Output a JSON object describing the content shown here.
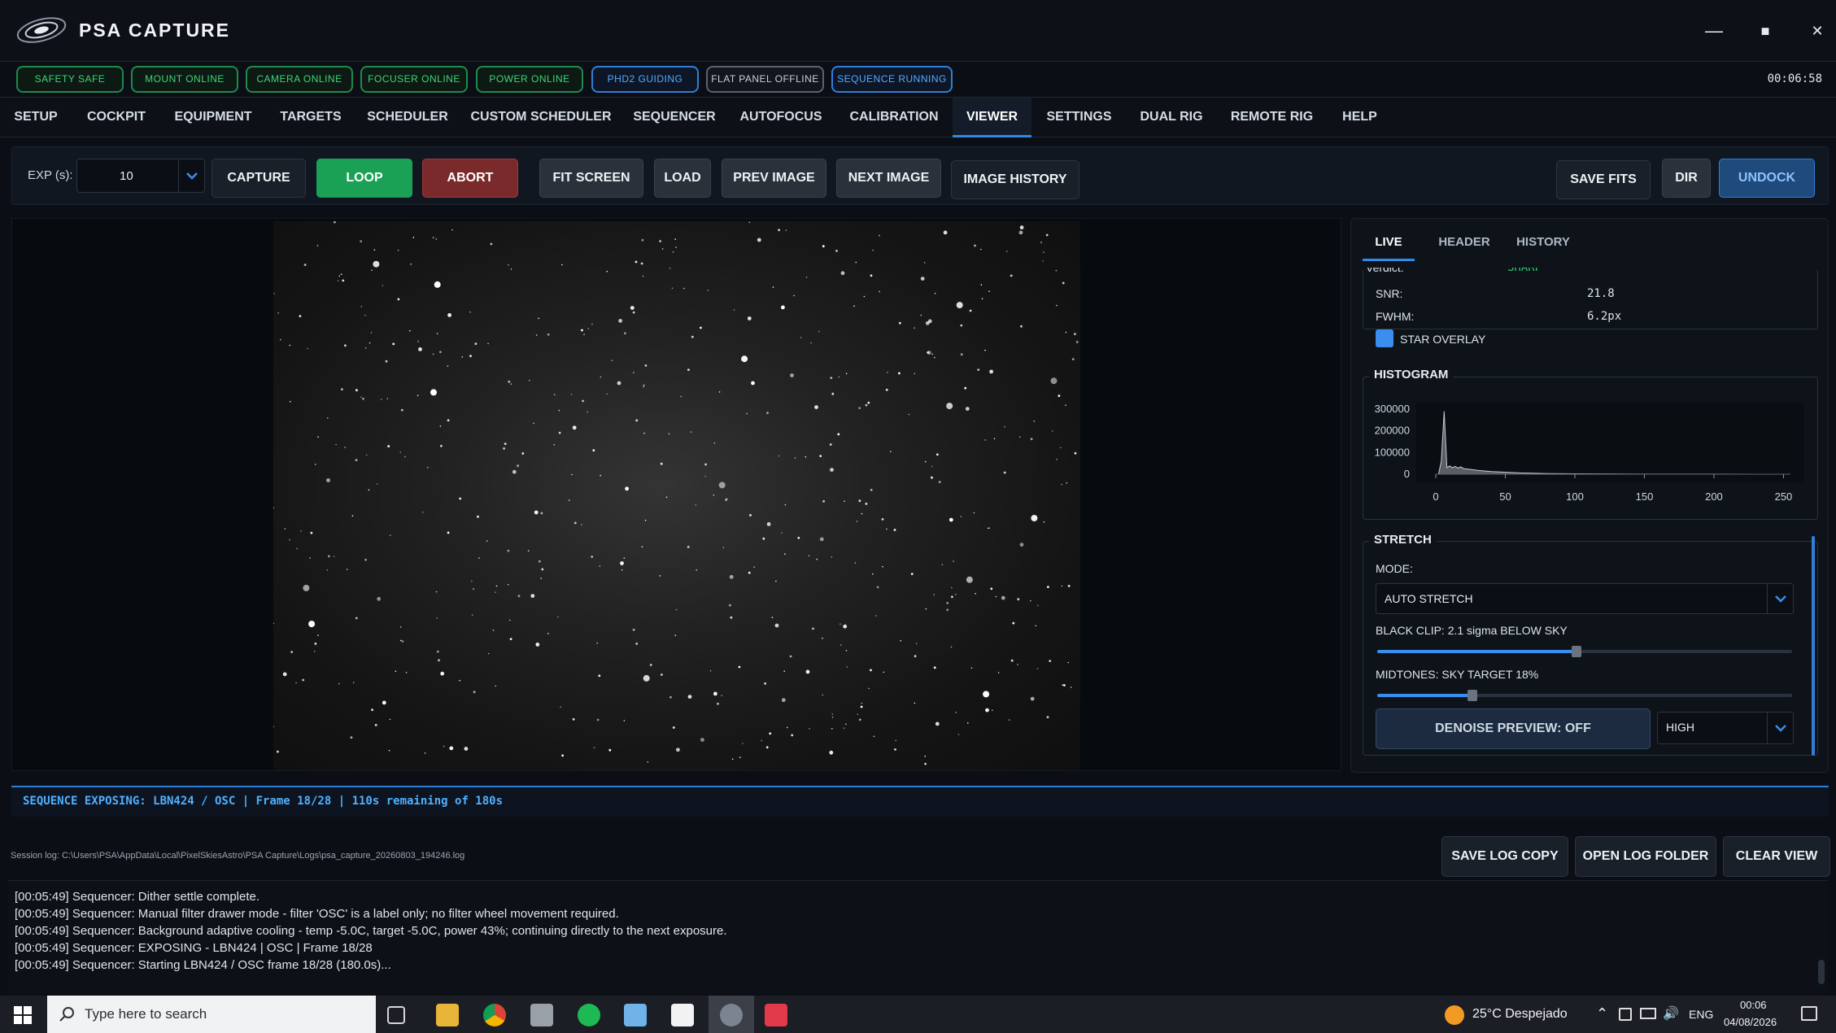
{
  "app": {
    "title": "PSA CAPTURE",
    "window": {
      "minimize": "—",
      "maximize": "■",
      "close": "✕"
    }
  },
  "status": {
    "pills": [
      {
        "label": "SAFETY SAFE",
        "kind": "green"
      },
      {
        "label": "MOUNT ONLINE",
        "kind": "green"
      },
      {
        "label": "CAMERA ONLINE",
        "kind": "green"
      },
      {
        "label": "FOCUSER ONLINE",
        "kind": "green"
      },
      {
        "label": "POWER ONLINE",
        "kind": "green"
      },
      {
        "label": "PHD2 GUIDING",
        "kind": "blue"
      },
      {
        "label": "FLAT PANEL OFFLINE",
        "kind": "grey"
      },
      {
        "label": "SEQUENCE RUNNING",
        "kind": "blue"
      }
    ],
    "elapsed": "00:06:58"
  },
  "tabs": [
    "SETUP",
    "COCKPIT",
    "EQUIPMENT",
    "TARGETS",
    "SCHEDULER",
    "CUSTOM SCHEDULER",
    "SEQUENCER",
    "AUTOFOCUS",
    "CALIBRATION",
    "VIEWER",
    "SETTINGS",
    "DUAL RIG",
    "REMOTE RIG",
    "HELP"
  ],
  "active_tab": "VIEWER",
  "toolbar": {
    "exp_label": "EXP (s):",
    "exp_value": "10",
    "capture": "CAPTURE",
    "loop": "LOOP",
    "abort": "ABORT",
    "fit_screen": "FIT SCREEN",
    "load": "LOAD",
    "prev_image": "PREV IMAGE",
    "next_image": "NEXT IMAGE",
    "image_history": "IMAGE HISTORY",
    "save_fits": "SAVE FITS",
    "dir": "DIR",
    "undock": "UNDOCK"
  },
  "side": {
    "tabs": [
      "LIVE",
      "HEADER",
      "HISTORY"
    ],
    "verdict_label": "Verdict:",
    "verdict_value": "SHARP",
    "snr_label": "SNR:",
    "snr_value": "21.8",
    "fwhm_label": "FWHM:",
    "fwhm_value": "6.2px",
    "star_overlay": "STAR OVERLAY",
    "histogram_title": "HISTOGRAM",
    "stretch_title": "STRETCH",
    "mode_label": "MODE:",
    "mode_value": "AUTO STRETCH",
    "black_clip": "BLACK CLIP: 2.1 sigma BELOW SKY",
    "black_clip_level": 0.48,
    "midtones": "MIDTONES: SKY TARGET 18%",
    "midtones_level": 0.23,
    "denoise_button": "DENOISE PREVIEW: OFF",
    "denoise_level": "HIGH"
  },
  "chart_data": {
    "type": "area",
    "title": "HISTOGRAM",
    "x": [
      0,
      2,
      4,
      6,
      8,
      10,
      12,
      14,
      16,
      18,
      20,
      25,
      30,
      40,
      60,
      80,
      100,
      150,
      200,
      250
    ],
    "values": [
      0,
      0,
      60000,
      290000,
      30000,
      38000,
      30000,
      36000,
      28000,
      34000,
      26000,
      22000,
      18000,
      12000,
      6000,
      3000,
      2000,
      500,
      200,
      0
    ],
    "xticks": [
      "0",
      "50",
      "100",
      "150",
      "200",
      "250"
    ],
    "yticks": [
      "300000",
      "200000",
      "100000",
      "0"
    ],
    "xlim": [
      0,
      255
    ],
    "ylim": [
      0,
      300000
    ],
    "color": "#9aa0a8"
  },
  "sequence_status": "SEQUENCE EXPOSING: LBN424 / OSC | Frame 18/28 | 110s remaining of 180s",
  "log": {
    "path": "Session log: C:\\Users\\PSA\\AppData\\Local\\PixelSkiesAstro\\PSA Capture\\Logs\\psa_capture_20260803_194246.log",
    "save_copy": "SAVE LOG COPY",
    "open_folder": "OPEN LOG FOLDER",
    "clear_view": "CLEAR VIEW",
    "lines": [
      "[00:05:49] Sequencer: Dither settle complete.",
      "[00:05:49] Sequencer: Manual filter drawer mode - filter 'OSC' is a label only; no filter wheel movement required.",
      "[00:05:49] Sequencer: Background adaptive cooling - temp -5.0C, target -5.0C, power 43%; continuing directly to the next exposure.",
      "[00:05:49] Sequencer: EXPOSING - LBN424 | OSC | Frame 18/28",
      "[00:05:49] Sequencer: Starting LBN424 / OSC frame 18/28 (180.0s)..."
    ]
  },
  "taskbar": {
    "search_placeholder": "Type here to search",
    "weather": "25°C  Despejado",
    "lang": "ENG",
    "time": "00:06",
    "date": "04/08/2026"
  }
}
